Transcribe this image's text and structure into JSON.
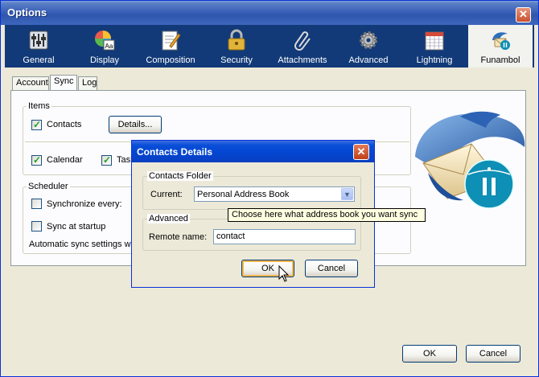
{
  "window": {
    "title": "Options",
    "close_label": "✕"
  },
  "toolbar": {
    "items": [
      {
        "label": "General"
      },
      {
        "label": "Display"
      },
      {
        "label": "Composition"
      },
      {
        "label": "Security"
      },
      {
        "label": "Attachments"
      },
      {
        "label": "Advanced"
      },
      {
        "label": "Lightning"
      },
      {
        "label": "Funambol"
      }
    ],
    "selected": "Funambol"
  },
  "tabs": [
    {
      "label": "Account"
    },
    {
      "label": "Sync"
    },
    {
      "label": "Log"
    }
  ],
  "items_group": {
    "title": "Items",
    "contacts_label": "Contacts",
    "contacts_checked": true,
    "details_button": "Details...",
    "calendar_label": "Calendar",
    "calendar_checked": true,
    "tasks_label": "Task",
    "tasks_checked": true
  },
  "scheduler_group": {
    "title": "Scheduler",
    "sync_every_label": "Synchronize every:",
    "sync_every_checked": false,
    "sync_startup_label": "Sync at startup",
    "sync_startup_checked": false,
    "auto_sync_text": "Automatic sync settings wi"
  },
  "buttons": {
    "ok": "OK",
    "cancel": "Cancel"
  },
  "dialog": {
    "title": "Contacts Details",
    "close_label": "✕",
    "folder_group_title": "Contacts Folder",
    "current_label": "Current:",
    "current_value": "Personal Address Book",
    "tooltip": "Choose here what address book you want sync",
    "advanced_group_title": "Advanced",
    "remote_name_label": "Remote name:",
    "remote_name_value": "contact",
    "ok": "OK",
    "cancel": "Cancel"
  }
}
